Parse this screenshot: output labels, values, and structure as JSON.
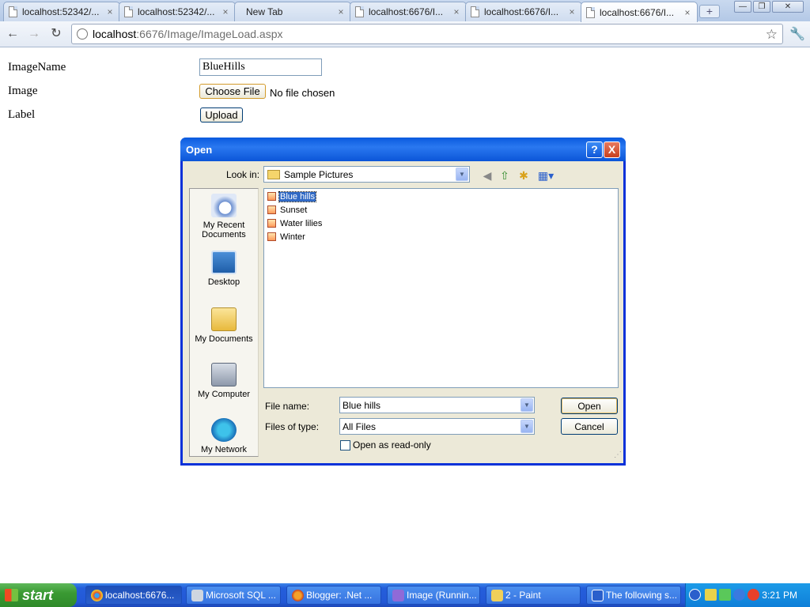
{
  "browser": {
    "tabs": [
      {
        "label": "localhost:52342/..."
      },
      {
        "label": "localhost:52342/..."
      },
      {
        "label": "New Tab"
      },
      {
        "label": "localhost:6676/I..."
      },
      {
        "label": "localhost:6676/I..."
      },
      {
        "label": "localhost:6676/I..."
      }
    ],
    "close_glyph": "×",
    "url_host": "localhost",
    "url_path": ":6676/Image/ImageLoad.aspx"
  },
  "page": {
    "imagename_label": "ImageName",
    "image_label": "Image",
    "label_label": "Label",
    "imagename_value": "BlueHills",
    "choose_file_label": "Choose File",
    "no_file_text": "No file chosen",
    "upload_label": "Upload"
  },
  "dialog": {
    "title": "Open",
    "help_glyph": "?",
    "close_glyph": "X",
    "look_in_label": "Look in:",
    "look_in_value": "Sample Pictures",
    "places": [
      {
        "label_line1": "My Recent",
        "label_line2": "Documents"
      },
      {
        "label_line1": "Desktop",
        "label_line2": ""
      },
      {
        "label_line1": "My Documents",
        "label_line2": ""
      },
      {
        "label_line1": "My Computer",
        "label_line2": ""
      },
      {
        "label_line1": "My Network",
        "label_line2": ""
      }
    ],
    "files": [
      "Blue hills",
      "Sunset",
      "Water lilies",
      "Winter"
    ],
    "file_name_label": "File name:",
    "file_name_value": "Blue hills",
    "files_of_type_label": "Files of type:",
    "files_of_type_value": "All Files",
    "open_label": "Open",
    "cancel_label": "Cancel",
    "readonly_label": "Open as read-only"
  },
  "taskbar": {
    "start_label": "start",
    "tasks": [
      {
        "label": "localhost:6676..."
      },
      {
        "label": "Microsoft SQL ..."
      },
      {
        "label": "Blogger: .Net ..."
      },
      {
        "label": "Image (Runnin..."
      },
      {
        "label": "2 - Paint"
      },
      {
        "label": "The following s..."
      }
    ],
    "clock": "3:21 PM"
  },
  "colors": {
    "xp_blue": "#0831d9",
    "selection": "#316ac5",
    "start_green": "#3a9a33"
  }
}
